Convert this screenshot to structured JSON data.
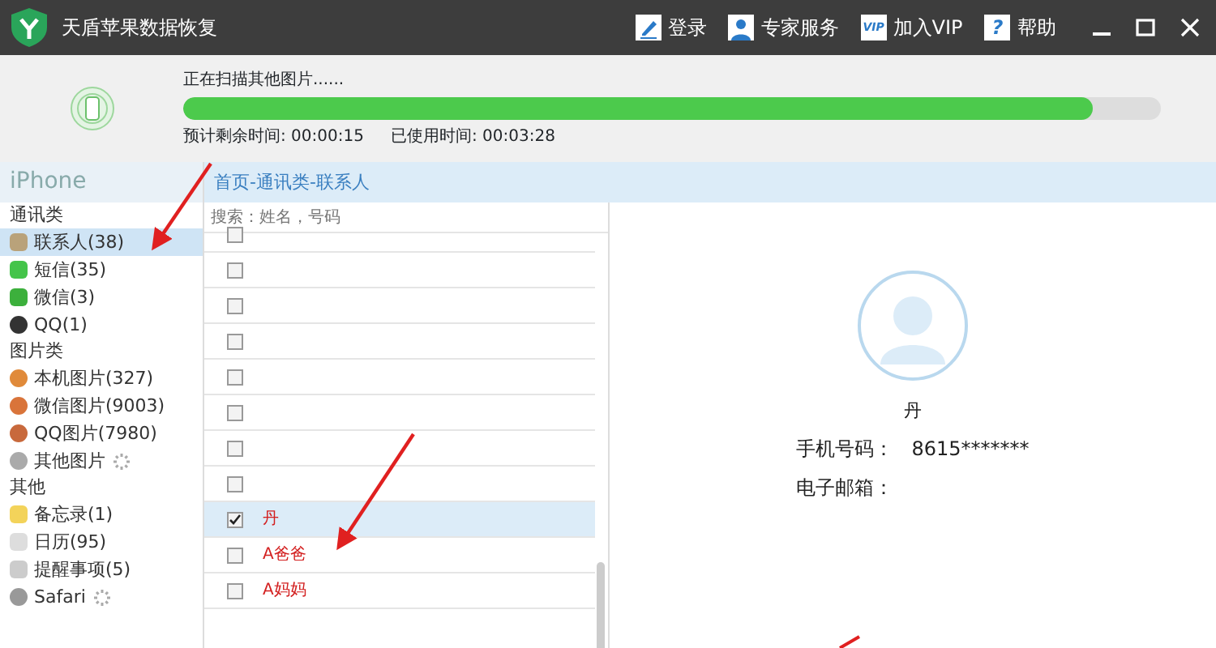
{
  "window": {
    "title": "天盾苹果数据恢复"
  },
  "header_actions": [
    {
      "label": "登录"
    },
    {
      "label": "专家服务"
    },
    {
      "label": "加入VIP",
      "icon_text": "VIP"
    },
    {
      "label": "帮助",
      "icon_text": "?"
    }
  ],
  "scan": {
    "status": "正在扫描其他图片......",
    "level": 0.93,
    "remaining": "预计剩余时间: 00:00:15",
    "elapsed": "已使用时间: 00:03:28"
  },
  "sidebar": {
    "device": "iPhone",
    "groups": [
      {
        "title": "通讯类",
        "items": [
          {
            "label": "联系人(38)",
            "selected": true,
            "loading": false
          },
          {
            "label": "短信(35)",
            "selected": false,
            "loading": false
          },
          {
            "label": "微信(3)",
            "selected": false,
            "loading": false
          },
          {
            "label": "QQ(1)",
            "selected": false,
            "loading": false
          }
        ]
      },
      {
        "title": "图片类",
        "items": [
          {
            "label": "本机图片(327)",
            "selected": false,
            "loading": false
          },
          {
            "label": "微信图片(9003)",
            "selected": false,
            "loading": false
          },
          {
            "label": "QQ图片(7980)",
            "selected": false,
            "loading": false
          },
          {
            "label": "其他图片",
            "selected": false,
            "loading": true
          }
        ]
      },
      {
        "title": "其他",
        "items": [
          {
            "label": "备忘录(1)",
            "selected": false,
            "loading": false
          },
          {
            "label": "日历(95)",
            "selected": false,
            "loading": false
          },
          {
            "label": "提醒事项(5)",
            "selected": false,
            "loading": false
          },
          {
            "label": "Safari",
            "selected": false,
            "loading": true
          }
        ]
      }
    ]
  },
  "breadcrumb": "首页-通讯类-联系人",
  "search": {
    "placeholder": "搜索：姓名，号码"
  },
  "contacts": [
    {
      "checked": false,
      "selected": false
    },
    {
      "checked": false,
      "selected": false
    },
    {
      "checked": false,
      "selected": false
    },
    {
      "checked": false,
      "selected": false
    },
    {
      "checked": false,
      "selected": false
    },
    {
      "checked": false,
      "selected": false
    },
    {
      "checked": false,
      "selected": false
    },
    {
      "checked": false,
      "selected": false
    },
    {
      "name": "丹",
      "checked": true,
      "selected": true
    },
    {
      "name": "A爸爸",
      "checked": false,
      "selected": false
    },
    {
      "name": "A妈妈",
      "checked": false,
      "selected": false
    }
  ],
  "detail": {
    "name": "丹",
    "fields": [
      {
        "label": "手机号码：",
        "value": "8615*******"
      },
      {
        "label": "电子邮箱："
      }
    ]
  }
}
